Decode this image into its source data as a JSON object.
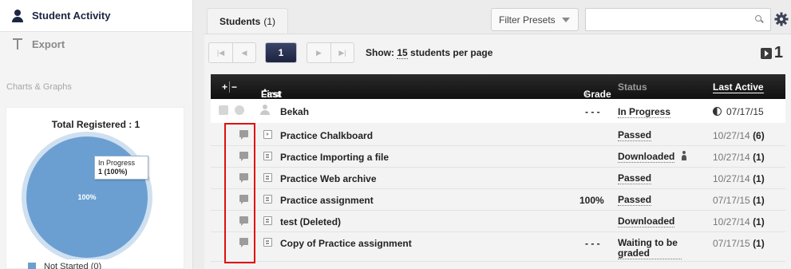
{
  "sidebar": {
    "nav": [
      {
        "label": "Student Activity",
        "icon": "person-icon",
        "active": true
      },
      {
        "label": "Export",
        "icon": "export-icon",
        "active": false
      }
    ],
    "section_heading": "Charts & Graphs",
    "chart": {
      "title": "Total Registered : 1",
      "tooltip_line1": "In Progress",
      "tooltip_line2": "1 (100%)",
      "slice_label": "100%",
      "legend_label": "Not Started (0)",
      "colors": {
        "slice": "#6b9fd2",
        "ring": "#cfe0f0",
        "legend": "#6b9fd2"
      }
    }
  },
  "chart_data": {
    "type": "pie",
    "title": "Total Registered : 1",
    "categories": [
      "In Progress",
      "Not Started"
    ],
    "values": [
      1,
      0
    ]
  },
  "header": {
    "tab_label": "Students",
    "tab_count": "(1)",
    "filter_presets_label": "Filter Presets",
    "search_placeholder": ""
  },
  "pager": {
    "current_page": "1",
    "show_prefix": "Show:",
    "per_page": "15",
    "show_suffix": "students per page",
    "total": "1"
  },
  "table": {
    "columns": {
      "expand": "+",
      "collapse": "−",
      "first_name": "First Name",
      "last_name": "Last Name",
      "grade": "Grade",
      "sep": "/",
      "status": "Status",
      "last_active": "Last Active"
    },
    "student": {
      "name": "Bekah",
      "grade": "- - -",
      "status": "In Progress",
      "last_active": "07/17/15"
    },
    "activities": [
      {
        "name": "Practice Chalkboard",
        "icon": "play",
        "grade": "",
        "status": "Passed",
        "date": "10/27/14",
        "count": "(6)",
        "downloaded_icon": false
      },
      {
        "name": "Practice Importing a file",
        "icon": "doc",
        "grade": "",
        "status": "Downloaded",
        "date": "10/27/14",
        "count": "(1)",
        "downloaded_icon": true
      },
      {
        "name": "Practice Web archive",
        "icon": "doc",
        "grade": "",
        "status": "Passed",
        "date": "10/27/14",
        "count": "(1)",
        "downloaded_icon": false
      },
      {
        "name": "Practice assignment",
        "icon": "doc",
        "grade": "100%",
        "status": "Passed",
        "date": "07/17/15",
        "count": "(1)",
        "downloaded_icon": false
      },
      {
        "name": "test (Deleted)",
        "icon": "doc",
        "grade": "",
        "status": "Downloaded",
        "date": "10/27/14",
        "count": "(1)",
        "downloaded_icon": false
      },
      {
        "name": "Copy of Practice assignment",
        "icon": "doc",
        "grade": "- - -",
        "status": "Waiting to be graded",
        "date": "07/17/15",
        "count": "(1)",
        "downloaded_icon": false
      }
    ]
  },
  "colors": {
    "accent_dark": "#1c2340",
    "highlight": "#e01010"
  }
}
